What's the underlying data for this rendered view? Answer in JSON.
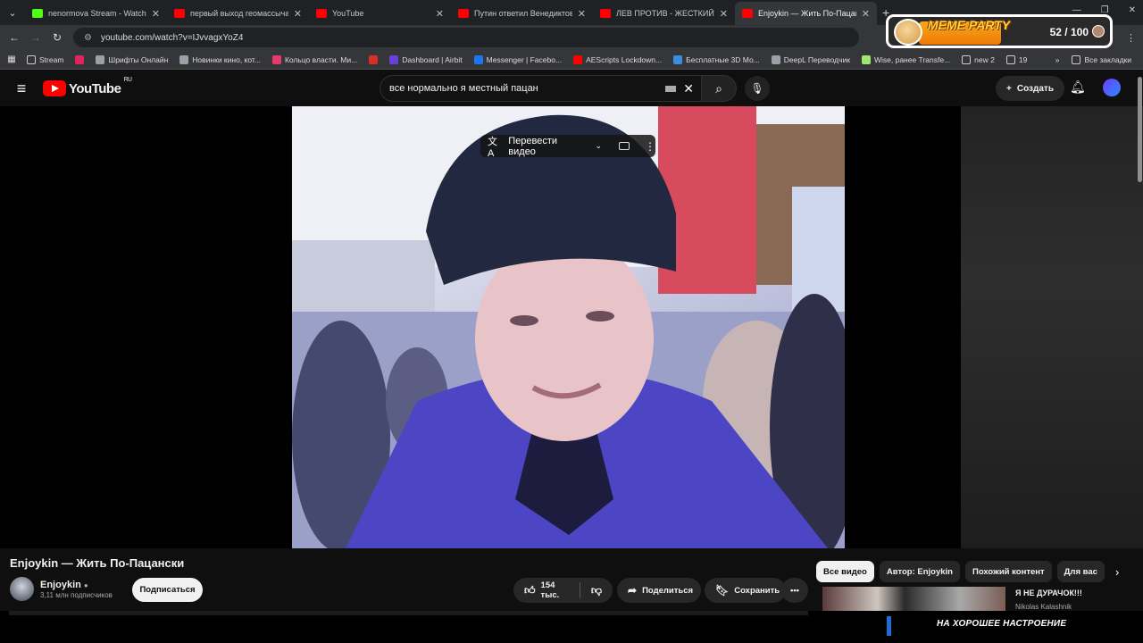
{
  "browser": {
    "tabs": [
      {
        "label": "nenormova Stream - Watch Liv",
        "favicon": "kick-icon",
        "active": false
      },
      {
        "label": "первый выход геомассыча - Y",
        "favicon": "youtube-icon",
        "active": false
      },
      {
        "label": "YouTube",
        "favicon": "youtube-icon",
        "active": false
      },
      {
        "label": "Путин ответил Венедиктову -",
        "favicon": "youtube-icon",
        "active": false
      },
      {
        "label": "ЛЕВ ПРОТИВ - ЖЕСТКИЙ ТРЭ",
        "favicon": "youtube-icon",
        "active": false
      },
      {
        "label": "Enjoykin — Жить По-Пацански",
        "favicon": "youtube-icon",
        "active": true
      }
    ],
    "url": "youtube.com/watch?v=IJvvagxYoZ4",
    "bookmarks": [
      {
        "label": "Stream",
        "icon": "folder-icon"
      },
      {
        "label": "",
        "icon": "site-icon-red"
      },
      {
        "label": "Шрифты Онлайн",
        "icon": "site-icon"
      },
      {
        "label": "Новинки кино, кот...",
        "icon": "site-icon"
      },
      {
        "label": "Кольцо власти. Ми...",
        "icon": "site-icon-r"
      },
      {
        "label": "",
        "icon": "gmail-icon"
      },
      {
        "label": "Dashboard | Airbit",
        "icon": "site-icon-purple"
      },
      {
        "label": "Messenger | Facebo...",
        "icon": "facebook-icon"
      },
      {
        "label": "AEScripts Lockdown...",
        "icon": "youtube-icon"
      },
      {
        "label": "Бесплатные 3D Мо...",
        "icon": "site-icon-3d"
      },
      {
        "label": "DeepL Переводчик",
        "icon": "site-icon"
      },
      {
        "label": "Wise, ранее Transfe...",
        "icon": "site-icon-wise"
      },
      {
        "label": "new 2",
        "icon": "folder-icon"
      },
      {
        "label": "19",
        "icon": "folder-icon"
      }
    ],
    "all_bookmarks": "Все закладки"
  },
  "overlay": {
    "title": "MEME PARTY",
    "count": "52 / 100",
    "progress_fraction": 0.52
  },
  "youtube": {
    "logo_text": "YouTube",
    "region": "RU",
    "search_value": "все нормально я местный пацан",
    "create_label": "Создать",
    "translate_label": "Перевести видео",
    "video_title": "Enjoykin — Жить По-Пацански",
    "channel_name": "Enjoykin",
    "channel_subs": "3,11 млн подписчиков",
    "subscribe_label": "Подписаться",
    "likes": "154 тыс.",
    "share_label": "Поделиться",
    "save_label": "Сохранить",
    "chips": [
      "Все видео",
      "Автор: Enjoykin",
      "Похожий контент",
      "Для вас"
    ],
    "rec_title": "Я НЕ ДУРАЧОК!!!",
    "rec_channel": "Nikolas Kalashnik"
  },
  "bottom_banner": "НА ХОРОШЕЕ НАСТРОЕНИЕ"
}
